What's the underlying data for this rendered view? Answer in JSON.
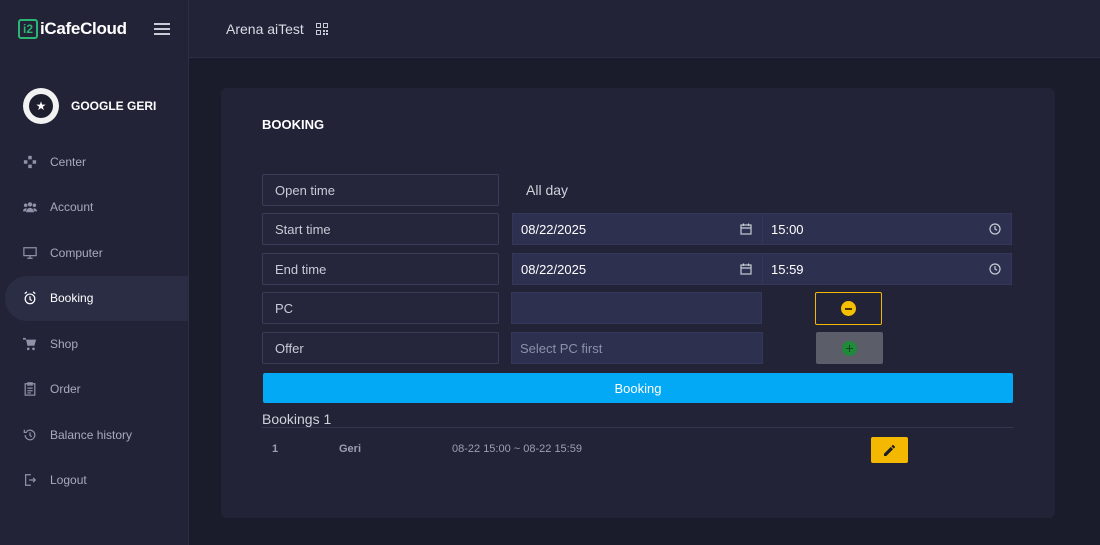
{
  "app": {
    "logo_prefix": "i2",
    "logo_text": "iCafeCloud",
    "brand_color": "#2bb673"
  },
  "profile": {
    "name": "GOOGLE GERI"
  },
  "sidebar": {
    "items": [
      {
        "label": "Center",
        "icon": "gamepad-icon"
      },
      {
        "label": "Account",
        "icon": "users-icon"
      },
      {
        "label": "Computer",
        "icon": "monitor-icon"
      },
      {
        "label": "Booking",
        "icon": "alarm-clock-icon",
        "active": true
      },
      {
        "label": "Shop",
        "icon": "cart-icon"
      },
      {
        "label": "Order",
        "icon": "clipboard-icon"
      },
      {
        "label": "Balance history",
        "icon": "history-icon"
      },
      {
        "label": "Logout",
        "icon": "logout-icon"
      }
    ]
  },
  "header": {
    "title": "Arena aiTest",
    "icon": "qr-code-icon"
  },
  "booking": {
    "title": "BOOKING",
    "open_time": {
      "label": "Open time",
      "value": "All day"
    },
    "start_time": {
      "label": "Start time",
      "date": "08/22/2025",
      "time": "15:00"
    },
    "end_time": {
      "label": "End time",
      "date": "08/22/2025",
      "time": "15:59"
    },
    "pc": {
      "label": "PC",
      "value": ""
    },
    "offer": {
      "label": "Offer",
      "placeholder": "Select PC first"
    },
    "submit_label": "Booking",
    "accent_color": "#03a9f4"
  },
  "bookings": {
    "heading": "Bookings 1",
    "rows": [
      {
        "index": "1",
        "name": "Geri",
        "range": "08-22 15:00 ~ 08-22 15:59"
      }
    ]
  }
}
